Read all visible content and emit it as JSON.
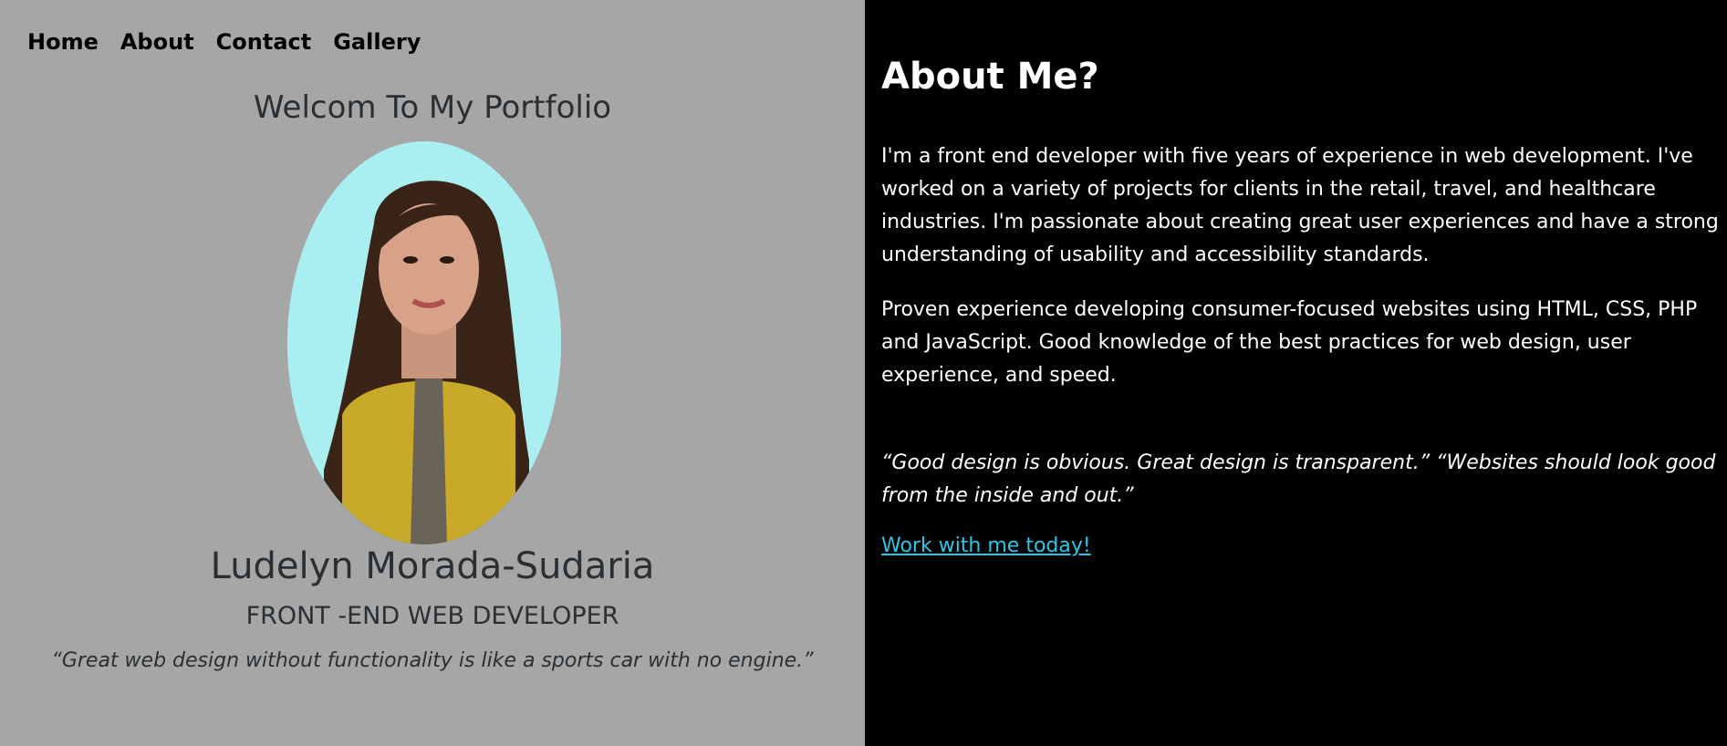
{
  "nav": {
    "items": [
      {
        "label": "Home"
      },
      {
        "label": "About"
      },
      {
        "label": "Contact"
      },
      {
        "label": "Gallery"
      }
    ]
  },
  "hero": {
    "welcome": "Welcom To My Portfolio",
    "name": "Ludelyn Morada-Sudaria",
    "role": "FRONT -END WEB DEVELOPER",
    "tagline": "“Great web design without functionality is like a sports car with no engine.”"
  },
  "about": {
    "title": "About Me?",
    "paragraph1": "I'm a front end developer with five years of experience in web development. I've worked on a variety of projects for clients in the retail, travel, and healthcare industries. I'm passionate about creating great user experiences and have a strong understanding of usability and accessibility standards.",
    "paragraph2": "Proven experience developing consumer-focused websites using HTML, CSS, PHP and JavaScript. Good knowledge of the best practices for web design, user experience, and speed.",
    "quote": "“Good design is obvious. Great design is transparent.” “Websites should look good from the inside and out.”",
    "cta": "Work with me today!"
  },
  "colors": {
    "left_background": "#a6a6a6",
    "right_background": "#000000",
    "link": "#2bc6e8",
    "photo_background": "#a9eef0"
  }
}
